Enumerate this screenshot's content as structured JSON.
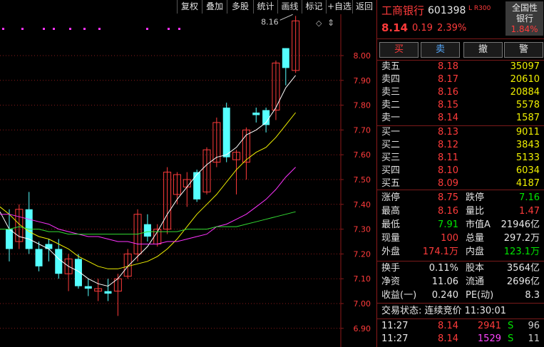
{
  "toolbar": {
    "buttons": [
      "复权",
      "叠加",
      "多股",
      "统计",
      "画线",
      "标记",
      "+自选",
      "返回"
    ]
  },
  "chart": {
    "price_axis": [
      "8.00",
      "7.90",
      "7.80",
      "7.70",
      "7.60",
      "7.50",
      "7.40",
      "7.30",
      "7.20",
      "7.10",
      "7.00",
      "6.90"
    ],
    "high_marker": "8.16",
    "colors": {
      "up": "#ff3b3b",
      "down": "#55ffff",
      "ma5": "#ffffff",
      "ma10": "#f0f000",
      "ma20": "#ff33ff",
      "ma60": "#33dd33",
      "grid": "#8b1a1a",
      "marker": "#ff33ff"
    },
    "chart_data": {
      "type": "candlestick",
      "ylim": [
        6.9,
        8.2
      ],
      "candles": [
        {
          "o": 7.3,
          "h": 7.38,
          "l": 7.17,
          "c": 7.22
        },
        {
          "o": 7.25,
          "h": 7.4,
          "l": 7.22,
          "c": 7.38
        },
        {
          "o": 7.38,
          "h": 7.45,
          "l": 7.2,
          "c": 7.22
        },
        {
          "o": 7.22,
          "h": 7.25,
          "l": 7.13,
          "c": 7.15
        },
        {
          "o": 7.24,
          "h": 7.26,
          "l": 7.17,
          "c": 7.22
        },
        {
          "o": 7.22,
          "h": 7.26,
          "l": 7.1,
          "c": 7.12
        },
        {
          "o": 7.12,
          "h": 7.2,
          "l": 7.05,
          "c": 7.18
        },
        {
          "o": 7.18,
          "h": 7.2,
          "l": 7.06,
          "c": 7.07
        },
        {
          "o": 7.07,
          "h": 7.1,
          "l": 7.03,
          "c": 7.06
        },
        {
          "o": 7.05,
          "h": 7.1,
          "l": 7.01,
          "c": 7.06
        },
        {
          "o": 7.05,
          "h": 7.1,
          "l": 7.01,
          "c": 7.04
        },
        {
          "o": 7.05,
          "h": 7.12,
          "l": 6.95,
          "c": 7.1
        },
        {
          "o": 7.11,
          "h": 7.22,
          "l": 7.1,
          "c": 7.2
        },
        {
          "o": 7.2,
          "h": 7.38,
          "l": 7.17,
          "c": 7.36
        },
        {
          "o": 7.32,
          "h": 7.36,
          "l": 7.25,
          "c": 7.27
        },
        {
          "o": 7.24,
          "h": 7.32,
          "l": 7.23,
          "c": 7.3
        },
        {
          "o": 7.3,
          "h": 7.55,
          "l": 7.28,
          "c": 7.53
        },
        {
          "o": 7.44,
          "h": 7.53,
          "l": 7.4,
          "c": 7.52
        },
        {
          "o": 7.47,
          "h": 7.53,
          "l": 7.39,
          "c": 7.5
        },
        {
          "o": 7.53,
          "h": 7.54,
          "l": 7.41,
          "c": 7.42
        },
        {
          "o": 7.45,
          "h": 7.63,
          "l": 7.44,
          "c": 7.62
        },
        {
          "o": 7.57,
          "h": 7.75,
          "l": 7.55,
          "c": 7.73
        },
        {
          "o": 7.79,
          "h": 7.81,
          "l": 7.57,
          "c": 7.59
        },
        {
          "o": 7.58,
          "h": 7.62,
          "l": 7.44,
          "c": 7.61
        },
        {
          "o": 7.57,
          "h": 7.71,
          "l": 7.5,
          "c": 7.7
        },
        {
          "o": 7.77,
          "h": 7.79,
          "l": 7.73,
          "c": 7.76
        },
        {
          "o": 7.78,
          "h": 7.79,
          "l": 7.69,
          "c": 7.72
        },
        {
          "o": 7.78,
          "h": 7.98,
          "l": 7.74,
          "c": 7.97
        },
        {
          "o": 8.03,
          "h": 8.03,
          "l": 7.88,
          "c": 7.95
        },
        {
          "o": 7.94,
          "h": 8.16,
          "l": 7.93,
          "c": 8.14
        }
      ],
      "ma": [
        {
          "name": "MA5",
          "values": [
            7.37,
            7.3,
            7.27,
            7.26,
            7.24,
            7.22,
            7.18,
            7.15,
            7.13,
            7.1,
            7.08,
            7.07,
            7.1,
            7.15,
            7.19,
            7.23,
            7.29,
            7.36,
            7.42,
            7.47,
            7.52,
            7.56,
            7.59,
            7.6,
            7.63,
            7.68,
            7.7,
            7.73,
            7.79,
            7.87,
            7.92
          ]
        },
        {
          "name": "MA10",
          "values": [
            7.39,
            7.36,
            7.32,
            7.29,
            7.27,
            7.26,
            7.24,
            7.22,
            7.19,
            7.17,
            7.15,
            7.14,
            7.14,
            7.15,
            7.16,
            7.17,
            7.19,
            7.22,
            7.26,
            7.31,
            7.36,
            7.4,
            7.44,
            7.49,
            7.54,
            7.58,
            7.61,
            7.63,
            7.67,
            7.72,
            7.77
          ]
        },
        {
          "name": "MA20",
          "values": [
            7.36,
            7.36,
            7.35,
            7.34,
            7.33,
            7.32,
            7.3,
            7.29,
            7.28,
            7.27,
            7.27,
            7.26,
            7.25,
            7.25,
            7.24,
            7.24,
            7.24,
            7.25,
            7.25,
            7.26,
            7.27,
            7.28,
            7.31,
            7.32,
            7.34,
            7.36,
            7.39,
            7.42,
            7.46,
            7.51,
            7.55
          ]
        },
        {
          "name": "MA60",
          "values": [
            7.3,
            7.3,
            7.31,
            7.3,
            7.3,
            7.29,
            7.29,
            7.28,
            7.28,
            7.28,
            7.28,
            7.28,
            7.28,
            7.28,
            7.28,
            7.29,
            7.29,
            7.29,
            7.29,
            7.3,
            7.3,
            7.3,
            7.31,
            7.31,
            7.31,
            7.32,
            7.33,
            7.34,
            7.35,
            7.36,
            7.37
          ]
        }
      ]
    }
  },
  "quote": {
    "name": "工商银行",
    "code": "601398",
    "tags": "L R300",
    "sector": "全国性银行",
    "sector_change": "1.84%",
    "price": "8.14",
    "change": "0.19",
    "change_pct": "2.39%"
  },
  "trade_buttons": [
    "买",
    "卖",
    "撤",
    "警"
  ],
  "asks": [
    {
      "label": "卖五",
      "price": "8.18",
      "vol": "35097"
    },
    {
      "label": "卖四",
      "price": "8.17",
      "vol": "20610"
    },
    {
      "label": "卖三",
      "price": "8.16",
      "vol": "20884"
    },
    {
      "label": "卖二",
      "price": "8.15",
      "vol": "5578"
    },
    {
      "label": "卖一",
      "price": "8.14",
      "vol": "1587"
    }
  ],
  "bids": [
    {
      "label": "买一",
      "price": "8.13",
      "vol": "9011"
    },
    {
      "label": "买二",
      "price": "8.12",
      "vol": "3843"
    },
    {
      "label": "买三",
      "price": "8.11",
      "vol": "5133"
    },
    {
      "label": "买四",
      "price": "8.10",
      "vol": "6034"
    },
    {
      "label": "买五",
      "price": "8.09",
      "vol": "4187"
    }
  ],
  "stats1": [
    {
      "l1": "涨停",
      "v1": "8.75",
      "c1": "red",
      "l2": "跌停",
      "v2": "7.16",
      "c2": "green"
    },
    {
      "l1": "最高",
      "v1": "8.16",
      "c1": "red",
      "l2": "量比",
      "v2": "1.47",
      "c2": "red"
    },
    {
      "l1": "最低",
      "v1": "7.91",
      "c1": "green",
      "l2": "市值A",
      "v2": "21946亿",
      "c2": "white"
    },
    {
      "l1": "现量",
      "v1": "100",
      "c1": "red",
      "l2": "总量",
      "v2": "297.2万",
      "c2": "white"
    },
    {
      "l1": "外盘",
      "v1": "174.1万",
      "c1": "red",
      "l2": "内盘",
      "v2": "123.1万",
      "c2": "green"
    }
  ],
  "stats2": [
    {
      "l1": "换手",
      "v1": "0.11%",
      "l2": "股本",
      "v2": "3564亿"
    },
    {
      "l1": "净资",
      "v1": "11.06",
      "l2": "流通",
      "v2": "2696亿"
    },
    {
      "l1": "收益(一)",
      "v1": "0.240",
      "l2": "PE(动)",
      "v2": "8.3"
    }
  ],
  "status": "交易状态: 连续竞价 11:30:01",
  "ticks": [
    {
      "time": "11:27",
      "price": "8.14",
      "vol": "2941",
      "dir": "S",
      "n": "96"
    },
    {
      "time": "11:27",
      "price": "8.14",
      "vol": "1529",
      "dir": "S",
      "n": "11"
    }
  ]
}
